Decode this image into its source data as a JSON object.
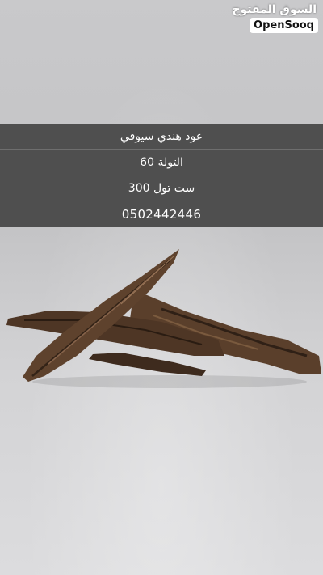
{
  "watermark": {
    "arabic": "السوق المفتوح",
    "brand": "OpenSooq"
  },
  "listing": {
    "lines": [
      "عود هندي سيوفي",
      "التولة 60",
      "ست تول  300",
      "0502442446"
    ]
  },
  "photo": {
    "subject": "agarwood-chips",
    "background_color": "#c9c9cb",
    "wood_color": "#4a3424"
  }
}
